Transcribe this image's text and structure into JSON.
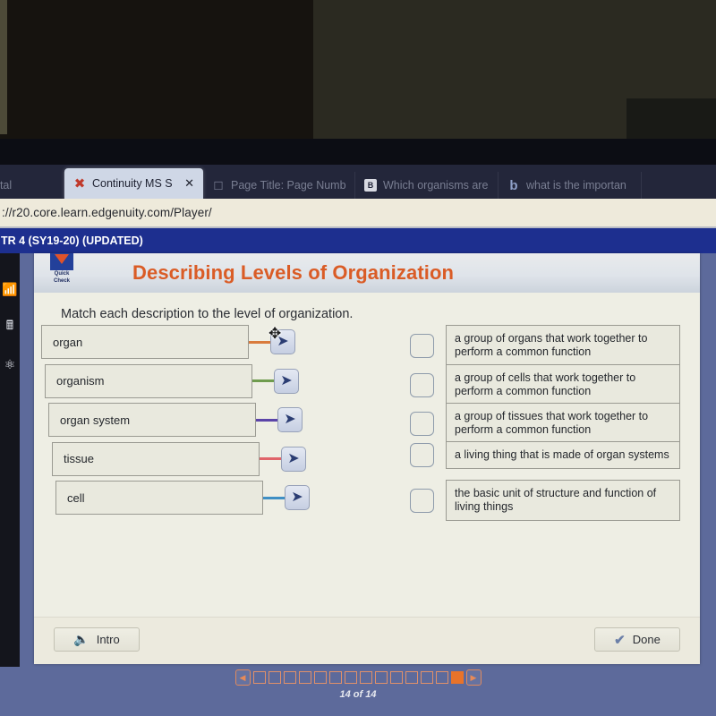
{
  "browser": {
    "tabs": [
      {
        "title": "VCS VPortal",
        "favicon": "globe-icon",
        "active": false
      },
      {
        "title": "Continuity MS Scie",
        "favicon": "red-x-icon",
        "active": true,
        "close": "✕"
      },
      {
        "title": "Page Title: Page Numb",
        "favicon": "document-icon",
        "active": false
      },
      {
        "title": "Which organisms are e",
        "favicon": "brainly-icon",
        "active": false
      },
      {
        "title": "what is the importan",
        "favicon": "bing-icon",
        "active": false
      }
    ],
    "url": "://r20.core.learn.edgenuity.com/Player/"
  },
  "course_header": {
    "title": "TR 4 (SY19-20) (UPDATED)"
  },
  "os_sidebar": {
    "icons": [
      "wifi-icon",
      "calculator-icon",
      "atom-icon"
    ]
  },
  "lesson": {
    "badge": {
      "line1": "Quick",
      "line2": "Check",
      "icon": "chevron-down-badge-icon"
    },
    "title": "Describing Levels of Organization",
    "instruction": "Match each description to the level of organization.",
    "terms": [
      {
        "label": "organ",
        "connector_color": "#d97b3c",
        "button_icon": "arrow-right-icon",
        "has_move_cursor": true
      },
      {
        "label": "organism",
        "connector_color": "#6f9c4e",
        "button_icon": "arrow-right-icon",
        "has_move_cursor": false
      },
      {
        "label": "organ system",
        "connector_color": "#5b44a8",
        "button_icon": "arrow-right-icon",
        "has_move_cursor": false
      },
      {
        "label": "tissue",
        "connector_color": "#e0646a",
        "button_icon": "arrow-right-icon",
        "has_move_cursor": false
      },
      {
        "label": "cell",
        "connector_color": "#3f8fc4",
        "button_icon": "arrow-right-icon",
        "has_move_cursor": false
      }
    ],
    "descriptions": [
      "a group of organs that work together to perform a common function",
      "a group of cells that work together to perform a common function",
      "a group of tissues that work together to perform a common function",
      "a living thing that is made of organ systems",
      "the basic unit of structure and function of living things"
    ],
    "footer": {
      "intro_label": "Intro",
      "intro_icon": "speaker-icon",
      "done_label": "Done",
      "done_icon": "checkmark-icon"
    }
  },
  "pagination": {
    "prev_icon": "◀",
    "next_icon": "▶",
    "total_pages": 14,
    "current_page": 14,
    "counter_label": "14 of 14"
  },
  "colors": {
    "accent_orange": "#da5c26",
    "header_blue": "#1d2f8f",
    "page_blue": "#5d6a9b",
    "panel": "#eeeee4"
  }
}
